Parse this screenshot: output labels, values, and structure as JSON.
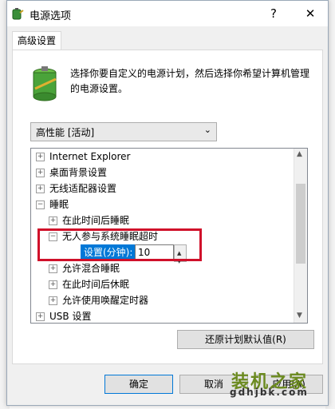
{
  "window": {
    "title": "电源选项",
    "help_label": "?",
    "close_label": "✕"
  },
  "tab": {
    "label": "高级设置"
  },
  "description": "选择你要自定义的电源计划，然后选择你希望计算机管理的电源设置。",
  "plan_select": {
    "value": "高性能 [活动]"
  },
  "tree": {
    "items": [
      {
        "label": "Internet Explorer",
        "expander": "+"
      },
      {
        "label": "桌面背景设置",
        "expander": "+"
      },
      {
        "label": "无线适配器设置",
        "expander": "+"
      },
      {
        "label": "睡眠",
        "expander": "−"
      },
      {
        "label": "在此时间后睡眠",
        "expander": "+"
      },
      {
        "label": "无人参与系统睡眠超时",
        "expander": "−"
      },
      {
        "label": "允许混合睡眠",
        "expander": "+"
      },
      {
        "label": "在此时间后休眠",
        "expander": "+"
      },
      {
        "label": "允许使用唤醒定时器",
        "expander": "+"
      },
      {
        "label": "USB 设置",
        "expander": "+"
      }
    ],
    "setting": {
      "label": "设置(分钟):",
      "value": "10"
    }
  },
  "restore_button": "还原计划默认值(R)",
  "buttons": {
    "ok": "确定",
    "cancel": "取消",
    "apply": "应用(A)"
  },
  "watermark": {
    "text": "装机之家",
    "url": "gdhjbk.com"
  },
  "colors": {
    "selection": "#0078d7",
    "highlight_border": "#d0102a",
    "watermark": "#6b8a1f"
  }
}
